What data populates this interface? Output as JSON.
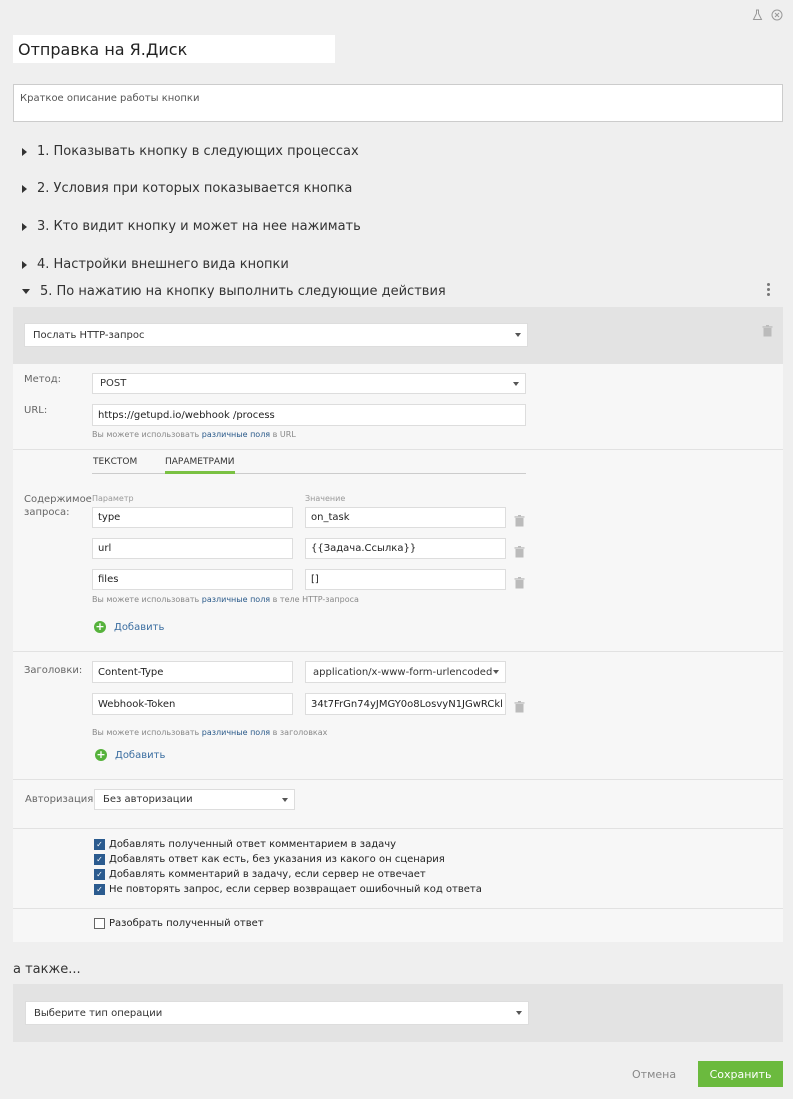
{
  "header": {
    "title": "Отправка на Я.Диск",
    "description_placeholder": "Краткое описание работы кнопки"
  },
  "sections": [
    {
      "label": "1. Показывать кнопку в следующих процессах",
      "expanded": false
    },
    {
      "label": "2. Условия при которых показывается кнопка",
      "expanded": false
    },
    {
      "label": "3. Кто видит кнопку и может на нее нажимать",
      "expanded": false
    },
    {
      "label": "4. Настройки внешнего вида кнопки",
      "expanded": false
    },
    {
      "label": "5. По нажатию на кнопку выполнить следующие действия",
      "expanded": true
    }
  ],
  "action": {
    "type": "Послать HTTP-запрос",
    "method_label": "Метод:",
    "method": "POST",
    "url_label": "URL:",
    "url": "https://getupd.io/webhook /process",
    "url_hint_prefix": "Вы можете использовать",
    "url_hint_link": "различные поля",
    "url_hint_suffix": "в URL",
    "tabs": [
      {
        "label": "ТЕКСТОМ",
        "active": false
      },
      {
        "label": "ПАРАМЕТРАМИ",
        "active": true
      }
    ],
    "body_label": "Содержимое запроса:",
    "param_col": "Параметр",
    "value_col": "Значение",
    "params": [
      {
        "name": "type",
        "value": "on_task"
      },
      {
        "name": "url",
        "value": "{{Задача.Ссылка}}"
      },
      {
        "name": "files",
        "value": "[]"
      }
    ],
    "body_hint_prefix": "Вы можете использовать",
    "body_hint_link": "различные поля",
    "body_hint_suffix": "в теле HTTP-запроса",
    "add_label": "Добавить",
    "headers_label": "Заголовки:",
    "headers": [
      {
        "name": "Content-Type",
        "value": "application/x-www-form-urlencoded"
      },
      {
        "name": "Webhook-Token",
        "value": "34t7FrGn74yJMGY0o8LosvyN1JGwRCkl"
      }
    ],
    "headers_hint_prefix": "Вы можете использовать",
    "headers_hint_link": "различные поля",
    "headers_hint_suffix": "в заголовках",
    "headers_add_label": "Добавить",
    "auth_label": "Авторизация:",
    "auth": "Без авторизации",
    "options": [
      {
        "label": "Добавлять полученный ответ комментарием в задачу",
        "checked": true
      },
      {
        "label": "Добавлять ответ как есть, без указания из какого он сценария",
        "checked": true
      },
      {
        "label": "Добавлять комментарий в задачу, если сервер не отвечает",
        "checked": true
      },
      {
        "label": "Не повторять запрос, если сервер возвращает ошибочный код ответа",
        "checked": true
      }
    ],
    "parse_option": {
      "label": "Разобрать полученный ответ",
      "checked": false
    }
  },
  "also": {
    "label": "а также...",
    "op_placeholder": "Выберите тип операции"
  },
  "footer": {
    "cancel": "Отмена",
    "save": "Сохранить"
  },
  "colors": {
    "accent_green": "#6bba3e",
    "tab_active_underline": "#7ac143",
    "link": "#2a5a8a",
    "checkbox": "#2b5b8f"
  },
  "icons": [
    "flask-icon",
    "close-circle-icon",
    "triangle-right-icon",
    "triangle-down-icon",
    "kebab-icon",
    "trash-icon",
    "plus-circle-icon",
    "chevron-down-icon"
  ]
}
